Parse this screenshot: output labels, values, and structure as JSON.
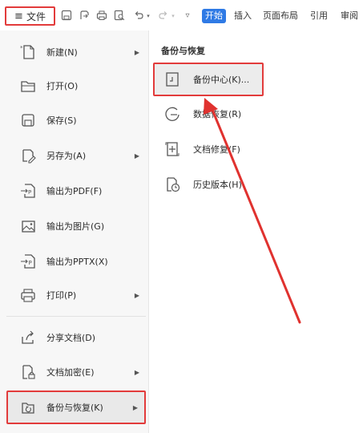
{
  "toolbar": {
    "file_label": "文件",
    "tabs": [
      "开始",
      "插入",
      "页面布局",
      "引用",
      "审阅"
    ],
    "active_tab": "开始"
  },
  "menu": {
    "items": [
      {
        "label": "新建(N)",
        "icon": "new-doc-icon",
        "arrow": true
      },
      {
        "label": "打开(O)",
        "icon": "folder-open-icon",
        "arrow": false
      },
      {
        "label": "保存(S)",
        "icon": "save-icon",
        "arrow": false
      },
      {
        "label": "另存为(A)",
        "icon": "save-as-icon",
        "arrow": true
      },
      {
        "label": "输出为PDF(F)",
        "icon": "export-pdf-icon",
        "arrow": false
      },
      {
        "label": "输出为图片(G)",
        "icon": "export-image-icon",
        "arrow": false
      },
      {
        "label": "输出为PPTX(X)",
        "icon": "export-pptx-icon",
        "arrow": false
      },
      {
        "label": "打印(P)",
        "icon": "print-icon",
        "arrow": true
      },
      {
        "label": "分享文档(D)",
        "icon": "share-icon",
        "arrow": false
      },
      {
        "label": "文档加密(E)",
        "icon": "encrypt-icon",
        "arrow": true
      },
      {
        "label": "备份与恢复(K)",
        "icon": "backup-icon",
        "arrow": true
      }
    ]
  },
  "submenu": {
    "title": "备份与恢复",
    "items": [
      {
        "label": "备份中心(K)...",
        "icon": "backup-center-icon"
      },
      {
        "label": "数据恢复(R)",
        "icon": "data-recovery-icon"
      },
      {
        "label": "文档修复(F)",
        "icon": "doc-repair-icon"
      },
      {
        "label": "历史版本(H)",
        "icon": "history-version-icon"
      }
    ]
  },
  "colors": {
    "highlight_border": "#e23b3b",
    "accent_blue": "#2f7ae5",
    "arrow_red": "#e0322f"
  }
}
